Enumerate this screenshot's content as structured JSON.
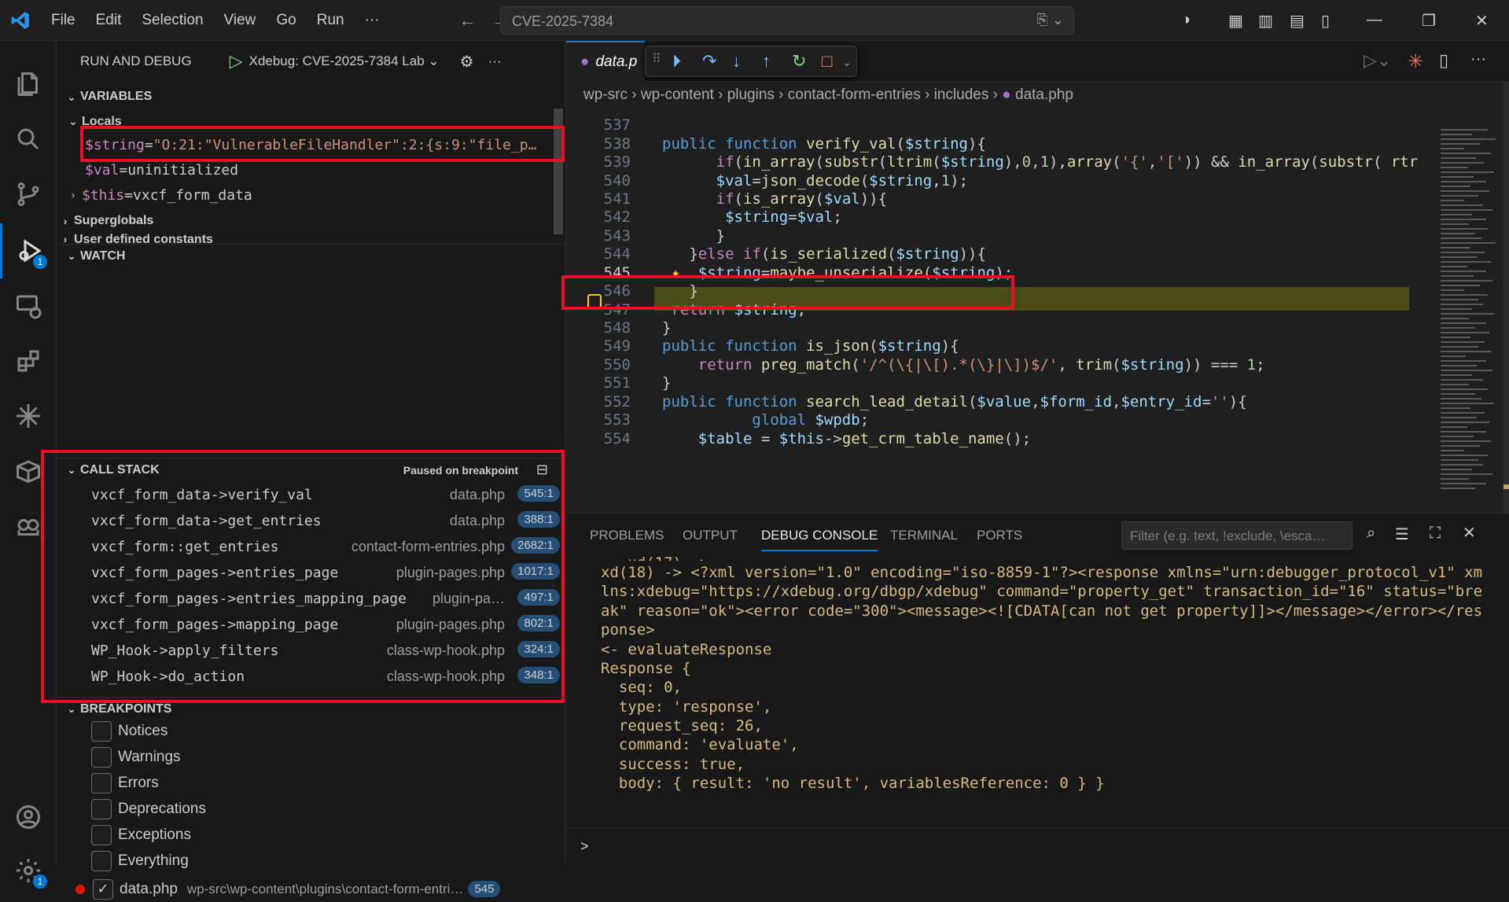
{
  "titlebar": {
    "menus": [
      "File",
      "Edit",
      "Selection",
      "View",
      "Go",
      "Run",
      "···"
    ],
    "search_text": "CVE-2025-7384"
  },
  "activity_badges": {
    "debug": "1",
    "settings": "1"
  },
  "sidebar": {
    "title": "RUN AND DEBUG",
    "config_name": "Xdebug: CVE-2025-7384 Lab",
    "variables_header": "VARIABLES",
    "locals_header": "Locals",
    "locals": [
      {
        "name": "$string",
        "eq": " = ",
        "value": "\"O:21:\"VulnerableFileHandler\":2:{s:9:\"file_p…"
      },
      {
        "name": "$val",
        "eq": " = ",
        "value": "uninitialized"
      },
      {
        "name": "$this",
        "eq": " = ",
        "value": "vxcf_form_data"
      }
    ],
    "superglobals": "Superglobals",
    "user_defined": "User defined constants",
    "watch_header": "WATCH",
    "callstack_header": "CALL STACK",
    "paused_label": "Paused on breakpoint",
    "callstack": [
      {
        "fn": "vxcf_form_data->verify_val",
        "file": "data.php",
        "line": "545:1"
      },
      {
        "fn": "vxcf_form_data->get_entries",
        "file": "data.php",
        "line": "388:1"
      },
      {
        "fn": "vxcf_form::get_entries",
        "file": "contact-form-entries.php",
        "line": "2682:1"
      },
      {
        "fn": "vxcf_form_pages->entries_page",
        "file": "plugin-pages.php",
        "line": "1017:1"
      },
      {
        "fn": "vxcf_form_pages->entries_mapping_page",
        "file": "plugin-pa…",
        "line": "497:1"
      },
      {
        "fn": "vxcf_form_pages->mapping_page",
        "file": "plugin-pages.php",
        "line": "802:1"
      },
      {
        "fn": "WP_Hook->apply_filters",
        "file": "class-wp-hook.php",
        "line": "324:1"
      },
      {
        "fn": "WP_Hook->do_action",
        "file": "class-wp-hook.php",
        "line": "348:1"
      }
    ],
    "breakpoints_header": "BREAKPOINTS",
    "breakpoints": [
      "Notices",
      "Warnings",
      "Errors",
      "Deprecations",
      "Exceptions",
      "Everything"
    ],
    "bp_file": {
      "name": "data.php",
      "path": "wp-src\\wp-content\\plugins\\contact-form-entri…",
      "line": "545"
    }
  },
  "editor": {
    "tab_label": "data.p",
    "breadcrumb": [
      "wp-src",
      "wp-content",
      "plugins",
      "contact-form-entries",
      "includes",
      "data.php"
    ],
    "line_numbers": [
      "537",
      "538",
      "539",
      "540",
      "541",
      "542",
      "543",
      "544",
      "545",
      "546",
      "547",
      "548",
      "549",
      "550",
      "551",
      "552",
      "553",
      "554"
    ]
  },
  "panel": {
    "tabs": [
      "PROBLEMS",
      "OUTPUT",
      "DEBUG CONSOLE",
      "TERMINAL",
      "PORTS"
    ],
    "filter_placeholder": "Filter (e.g. text, !exclude, \\esca…",
    "console": [
      "xd(18) -> <?xml version=\"1.0\" encoding=\"iso-8859-1\"?><response xmlns=\"urn:debugger_protocol_v1\" xm",
      "lns:xdebug=\"https://xdebug.org/dbgp/xdebug\" command=\"property_get\" transaction_id=\"16\" status=\"bre",
      "ak\" reason=\"ok\"><error code=\"300\"><message><![CDATA[can not get property]]></message></error></res",
      "ponse>",
      "<- evaluateResponse",
      "Response {",
      "  seq: 0,",
      "  type: 'response',",
      "  request_seq: 26,",
      "  command: 'evaluate',",
      "  success: true,",
      "  body: { result: 'no result', variablesReference: 0 } }"
    ],
    "prompt": ">"
  },
  "colors": {
    "accent": "#0078d4",
    "highlight_box": "#e81123",
    "breakpoint": "#e51400"
  }
}
